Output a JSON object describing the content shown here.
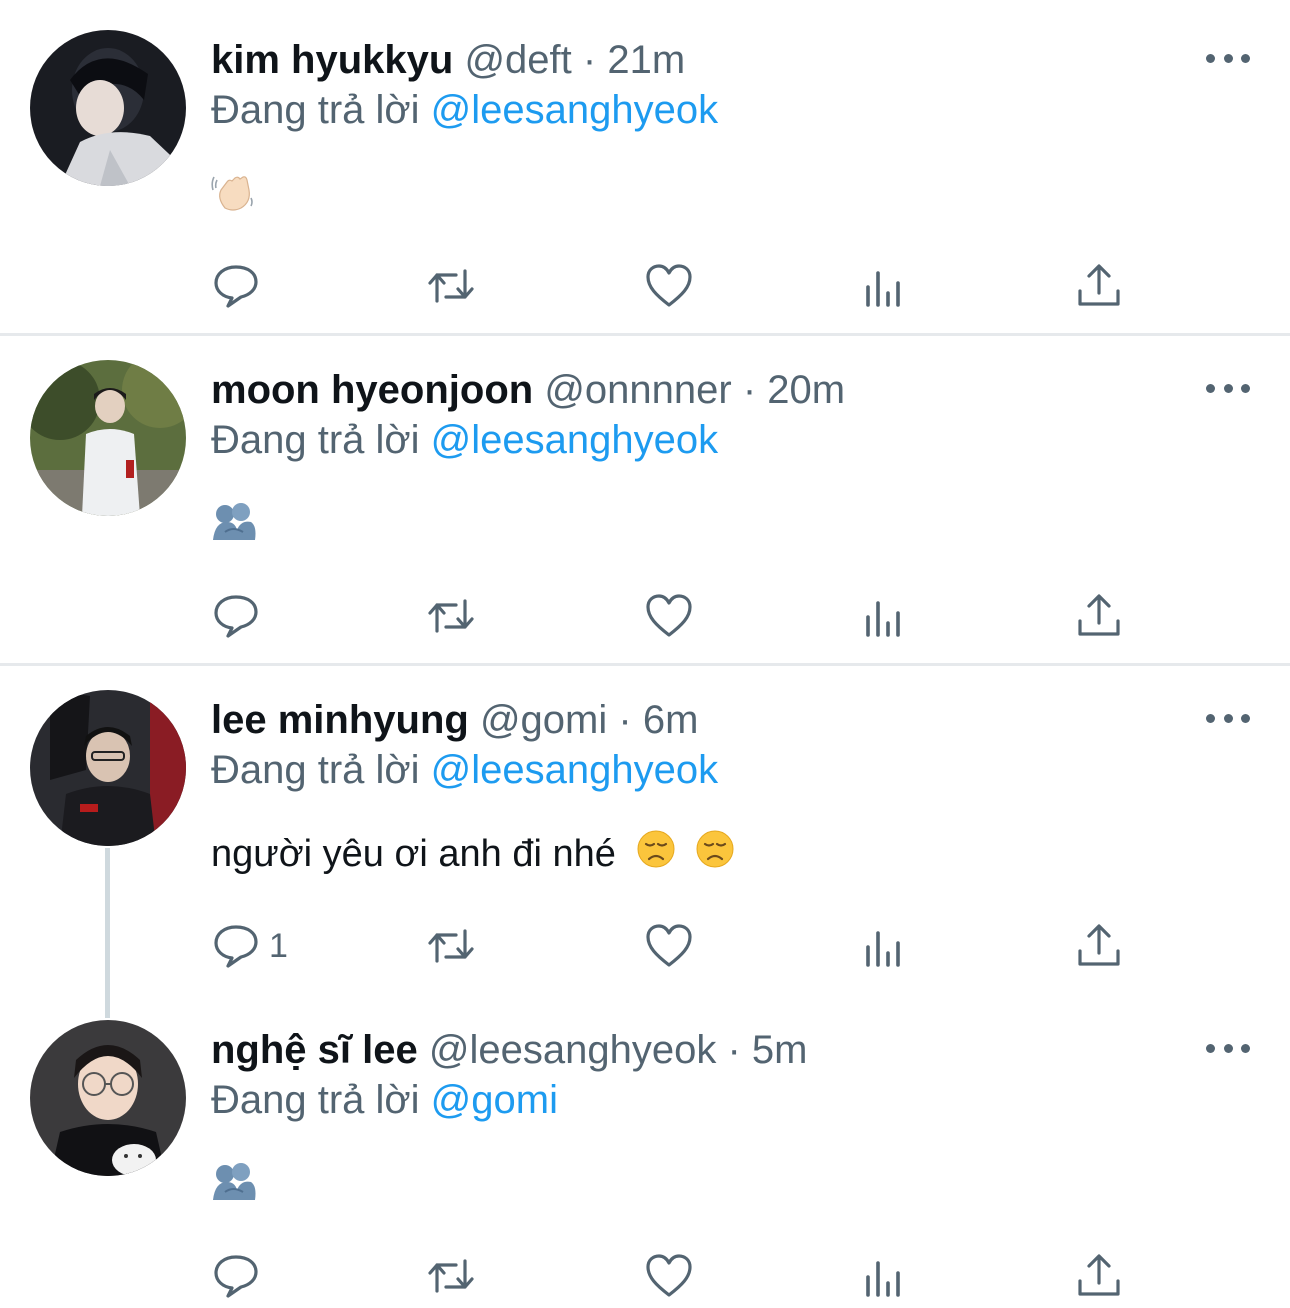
{
  "icons": {
    "reply": "reply-icon",
    "retweet": "retweet-icon",
    "like": "heart-icon",
    "views": "views-bar-chart-icon",
    "share": "share-icon",
    "more": "more-dots-icon"
  },
  "colors": {
    "text": "#0f1419",
    "muted": "#536471",
    "mention": "#1d9bf0",
    "divider": "#e6e9ec",
    "thread_line": "#cfd9de"
  },
  "tweets": [
    {
      "name": "kim hyukkyu",
      "handle": "@deft",
      "sep": "·",
      "time": "21m",
      "reply_prefix": "Đang trả lời",
      "reply_to": "@leesanghyeok",
      "text": "",
      "emojis": [
        "waving-hand"
      ],
      "reply_count": ""
    },
    {
      "name": "moon hyeonjoon",
      "handle": "@onnnner",
      "sep": "·",
      "time": "20m",
      "reply_prefix": "Đang trả lời",
      "reply_to": "@leesanghyeok",
      "text": "",
      "emojis": [
        "people-hugging"
      ],
      "reply_count": ""
    },
    {
      "name": "lee minhyung",
      "handle": "@gomi",
      "sep": "·",
      "time": "6m",
      "reply_prefix": "Đang trả lời",
      "reply_to": "@leesanghyeok",
      "text": "người yêu ơi anh đi nhé",
      "emojis": [
        "disappointed-face",
        "disappointed-face"
      ],
      "reply_count": "1"
    },
    {
      "name": "nghệ sĩ lee",
      "handle": "@leesanghyeok",
      "sep": "·",
      "time": "5m",
      "reply_prefix": "Đang trả lời",
      "reply_to": "@gomi",
      "text": "",
      "emojis": [
        "people-hugging"
      ],
      "reply_count": ""
    }
  ]
}
